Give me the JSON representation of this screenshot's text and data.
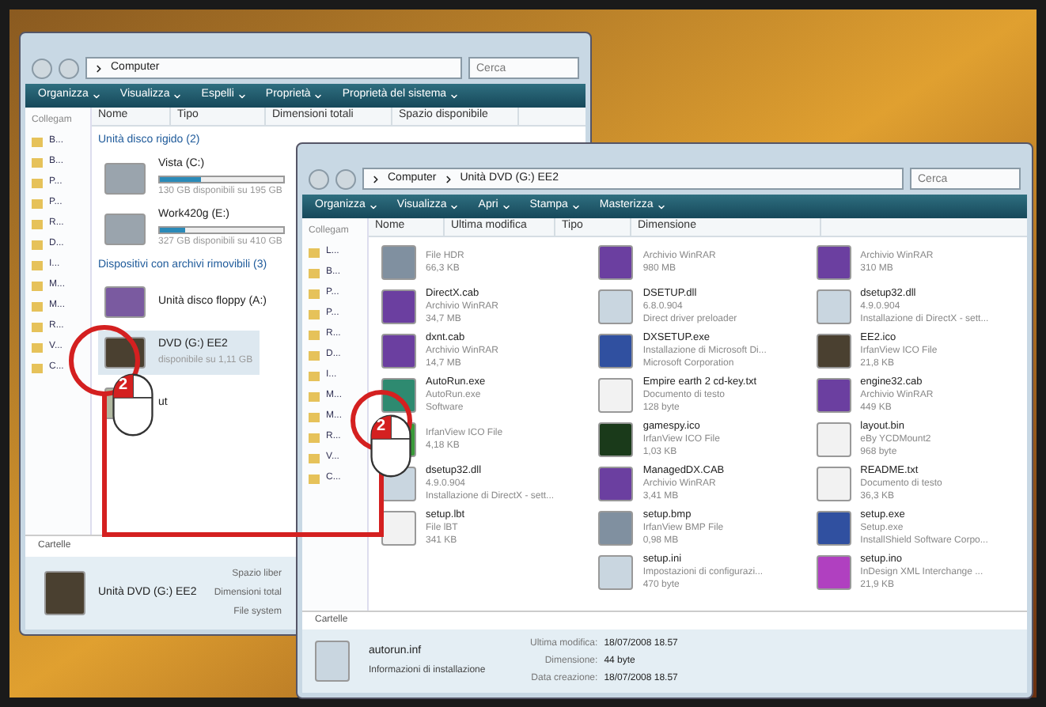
{
  "left_window": {
    "address": [
      "Computer"
    ],
    "search": {
      "placeholder": "Cerca"
    },
    "toolbar": [
      "Organizza",
      "Visualizza",
      "Espelli",
      "Proprietà",
      "Proprietà del sistema"
    ],
    "columns": [
      "Nome",
      "Tipo",
      "Dimensioni totali",
      "Spazio disponibile"
    ],
    "links_header": "Collegam",
    "links": [
      "B...",
      "B...",
      "P...",
      "P...",
      "R...",
      "D...",
      "I...",
      "M...",
      "M...",
      "R...",
      "V...",
      "C..."
    ],
    "groups": [
      {
        "title": "Unità disco rigido (2)",
        "items": [
          {
            "kind": "disk",
            "name": "Vista (C:)",
            "level": 0.33,
            "detail": "130 GB disponibili su 195 GB"
          },
          {
            "kind": "disk",
            "name": "Work420g (E:)",
            "level": 0.2,
            "detail": "327 GB disponibili su 410 GB"
          }
        ]
      },
      {
        "title": "Dispositivi con archivi rimovibili (3)",
        "items": [
          {
            "kind": "floppy",
            "name": "Unità disco floppy (A:)"
          },
          {
            "kind": "dvd",
            "name": "DVD (G:) EE2",
            "detail": "disponibile su 1,11 GB",
            "selected": true
          },
          {
            "kind": "setup",
            "name": "ut"
          }
        ]
      }
    ],
    "folders": "Cartelle",
    "details": {
      "name": "Unità DVD (G:) EE2",
      "labels": [
        "Spazio liber",
        "Dimensioni total",
        "File system"
      ]
    }
  },
  "right_window": {
    "address": [
      "Computer",
      "Unità DVD (G:) EE2"
    ],
    "search": {
      "placeholder": "Cerca"
    },
    "toolbar": [
      "Organizza",
      "Visualizza",
      "Apri",
      "Stampa",
      "Masterizza"
    ],
    "columns": [
      "Nome",
      "Ultima modifica",
      "Tipo",
      "Dimensione"
    ],
    "links_header": "Collegam",
    "links": [
      "L...",
      "B...",
      "P...",
      "P...",
      "R...",
      "D...",
      "I...",
      "M...",
      "M...",
      "R...",
      "V...",
      "C..."
    ],
    "file_columns": [
      [
        {
          "kind": "image",
          "lines": [
            "File HDR",
            "66,3 KB"
          ]
        },
        {
          "kind": "archive",
          "name": "DirectX.cab",
          "lines": [
            "Archivio WinRAR",
            "34,7 MB"
          ]
        },
        {
          "kind": "archive",
          "name": "dxnt.cab",
          "lines": [
            "Archivio WinRAR",
            "14,7 MB"
          ]
        },
        {
          "kind": "window",
          "name": "AutoRun.exe",
          "lines": [
            "AutoRun.exe",
            "Software"
          ]
        },
        {
          "kind": "flask",
          "lines": [
            "IrfanView ICO File",
            "4,18 KB"
          ]
        },
        {
          "kind": "settings",
          "name": "dsetup32.dll",
          "lines": [
            "4.9.0.904",
            "Installazione di DirectX - sett..."
          ]
        },
        {
          "kind": "doc",
          "name": "setup.lbt",
          "lines": [
            "File lBT",
            "341 KB"
          ]
        }
      ],
      [
        {
          "kind": "archive",
          "lines": [
            "Archivio WinRAR",
            "980 MB"
          ]
        },
        {
          "kind": "settings",
          "name": "DSETUP.dll",
          "lines": [
            "6.8.0.904",
            "Direct driver preloader"
          ]
        },
        {
          "kind": "app",
          "name": "DXSETUP.exe",
          "lines": [
            "Installazione di Microsoft Di...",
            "Microsoft Corporation"
          ]
        },
        {
          "kind": "doc",
          "name": "Empire earth 2 cd-key.txt",
          "lines": [
            "Documento di testo",
            "128 byte"
          ]
        },
        {
          "kind": "globe",
          "name": "gamespy.ico",
          "lines": [
            "IrfanView ICO File",
            "1,03 KB"
          ]
        },
        {
          "kind": "archive",
          "name": "ManagedDX.CAB",
          "lines": [
            "Archivio WinRAR",
            "3,41 MB"
          ]
        },
        {
          "kind": "image",
          "name": "setup.bmp",
          "lines": [
            "IrfanView BMP File",
            "0,98 MB"
          ]
        },
        {
          "kind": "settings",
          "name": "setup.ini",
          "lines": [
            "Impostazioni di configurazi...",
            "470 byte"
          ]
        }
      ],
      [
        {
          "kind": "archive",
          "lines": [
            "Archivio WinRAR",
            "310 MB"
          ]
        },
        {
          "kind": "settings",
          "name": "dsetup32.dll",
          "lines": [
            "4.9.0.904",
            "Installazione di DirectX - sett..."
          ]
        },
        {
          "kind": "logo",
          "name": "EE2.ico",
          "lines": [
            "IrfanView ICO File",
            "21,8 KB"
          ]
        },
        {
          "kind": "archive",
          "name": "engine32.cab",
          "lines": [
            "Archivio WinRAR",
            "449 KB"
          ]
        },
        {
          "kind": "doc",
          "name": "layout.bin",
          "lines": [
            "eBy YCDMount2",
            "968 byte"
          ]
        },
        {
          "kind": "doc",
          "name": "README.txt",
          "lines": [
            "Documento di testo",
            "36,3 KB"
          ]
        },
        {
          "kind": "app",
          "name": "setup.exe",
          "lines": [
            "Setup.exe",
            "InstallShield Software Corpo..."
          ]
        },
        {
          "kind": "xml",
          "name": "setup.ino",
          "lines": [
            "InDesign XML Interchange ...",
            "21,9 KB"
          ]
        }
      ]
    ],
    "folders": "Cartelle",
    "details": {
      "name": "autorun.inf",
      "type": "Informazioni di installazione",
      "fields": [
        {
          "label": "Ultima modifica:",
          "value": "18/07/2008 18.57"
        },
        {
          "label": "Dimensione:",
          "value": "44 byte"
        },
        {
          "label": "Data creazione:",
          "value": "18/07/2008 18.57"
        }
      ]
    }
  },
  "step_labels": [
    "2",
    "2"
  ]
}
